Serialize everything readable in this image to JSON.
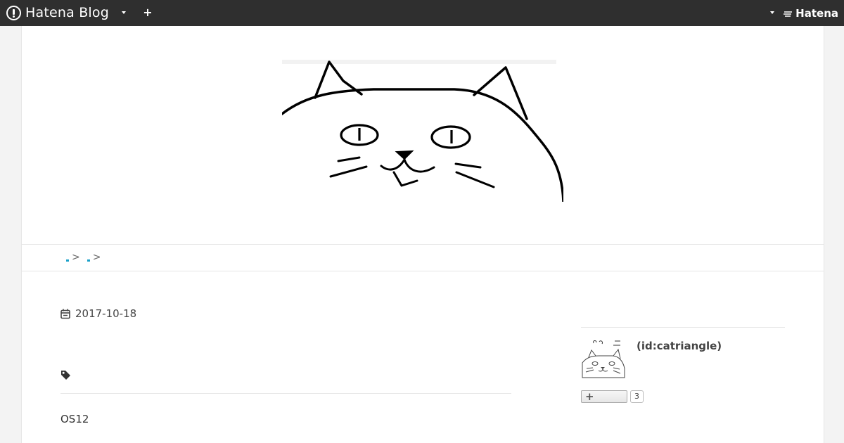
{
  "topbar": {
    "brand_name": "Hatena Blog",
    "hatena_label": "Hatena",
    "icons": [
      "hatena-blog-logo-icon",
      "dropdown-caret-icon",
      "plus-icon",
      "hatena-logo-icon"
    ]
  },
  "breadcrumb": {
    "separators": [
      ">",
      ">"
    ]
  },
  "entry": {
    "date": "2017-10-18",
    "text": "OS12"
  },
  "profile": {
    "id_label": "(id:catriangle)",
    "follow_count": "3"
  },
  "colors": {
    "topbar_bg": "#2f2f2f",
    "page_bg": "#f3f3f3",
    "content_bg": "#ffffff",
    "divider": "#e6e6e6"
  }
}
